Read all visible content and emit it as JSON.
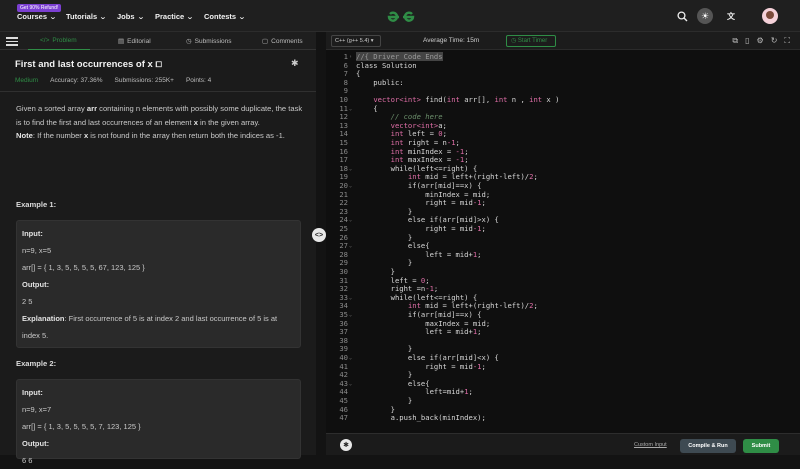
{
  "topnav": {
    "badge": "Get 90% Refund!",
    "items": [
      "Courses",
      "Tutorials",
      "Jobs",
      "Practice",
      "Contests"
    ],
    "logo": "GfG",
    "icons": [
      "search-icon",
      "sun-icon",
      "translate-icon",
      "avatar"
    ]
  },
  "tabs": [
    "Problem",
    "Editorial",
    "Submissions",
    "Comments"
  ],
  "problem": {
    "title": "First and last occurrences of x",
    "difficulty": "Medium",
    "accuracy": "Accuracy: 37.36%",
    "submissions": "Submissions: 255K+",
    "points": "Points: 4",
    "desc_1": "Given a sorted array ",
    "desc_arr": "arr",
    "desc_2": " containing n elements with possibly some duplicate, the task is to find the first and last occurrences of an element ",
    "desc_x": "x",
    "desc_3": " in the given array.",
    "note_label": "Note",
    "note_1": ": If the number ",
    "note_x": "x",
    "note_2": " is not found in the array then return both the indices as -1."
  },
  "examples": [
    {
      "heading": "Example 1:",
      "input_label": "Input:",
      "input_1": "n=9, x=5",
      "input_2": "arr[] = { 1, 3, 5, 5, 5, 5, 67, 123, 125 }",
      "output_label": "Output:",
      "output": "2 5",
      "expl_label": "Explanation",
      "expl": ": First occurrence of 5 is at index 2 and last occurrence of 5 is at index 5."
    },
    {
      "heading": "Example 2:",
      "input_label": "Input:",
      "input_1": "n=9, x=7",
      "input_2": "arr[] = { 1, 3, 5, 5, 5, 5, 7, 123, 125 }",
      "output_label": "Output:",
      "output": "6 6"
    }
  ],
  "editor": {
    "language": "C++ (g++ 5.4)",
    "avg_time": "Average Time: 15m",
    "timer": "Start Timer",
    "lines": [
      {
        "n": "1",
        "t": "//{ Driver Code Ends"
      },
      {
        "n": "6",
        "t": "class Solution"
      },
      {
        "n": "7",
        "t": "{"
      },
      {
        "n": "8",
        "t": "    public:"
      },
      {
        "n": "9",
        "t": ""
      },
      {
        "n": "10",
        "t": "    vector<int> find(int arr[], int n , int x )"
      },
      {
        "n": "11",
        "t": "    {"
      },
      {
        "n": "12",
        "t": "        // code here"
      },
      {
        "n": "13",
        "t": "        vector<int>a;"
      },
      {
        "n": "14",
        "t": "        int left = 0;"
      },
      {
        "n": "15",
        "t": "        int right = n-1;"
      },
      {
        "n": "16",
        "t": "        int minIndex = -1;"
      },
      {
        "n": "17",
        "t": "        int maxIndex = -1;"
      },
      {
        "n": "18",
        "t": "        while(left<=right) {"
      },
      {
        "n": "19",
        "t": "            int mid = left+(right-left)/2;"
      },
      {
        "n": "20",
        "t": "            if(arr[mid]==x) {"
      },
      {
        "n": "21",
        "t": "                minIndex = mid;"
      },
      {
        "n": "22",
        "t": "                right = mid-1;"
      },
      {
        "n": "23",
        "t": "            }"
      },
      {
        "n": "24",
        "t": "            else if(arr[mid]>x) {"
      },
      {
        "n": "25",
        "t": "                right = mid-1;"
      },
      {
        "n": "26",
        "t": "            }"
      },
      {
        "n": "27",
        "t": "            else{"
      },
      {
        "n": "28",
        "t": "                left = mid+1;"
      },
      {
        "n": "29",
        "t": "            }"
      },
      {
        "n": "30",
        "t": "        }"
      },
      {
        "n": "31",
        "t": "        left = 0;"
      },
      {
        "n": "32",
        "t": "        right =n-1;"
      },
      {
        "n": "33",
        "t": "        while(left<=right) {"
      },
      {
        "n": "34",
        "t": "            int mid = left+(right-left)/2;"
      },
      {
        "n": "35",
        "t": "            if(arr[mid]==x) {"
      },
      {
        "n": "36",
        "t": "                maxIndex = mid;"
      },
      {
        "n": "37",
        "t": "                left = mid+1;"
      },
      {
        "n": "38",
        "t": ""
      },
      {
        "n": "39",
        "t": "            }"
      },
      {
        "n": "40",
        "t": "            else if(arr[mid]<x) {"
      },
      {
        "n": "41",
        "t": "                right = mid-1;"
      },
      {
        "n": "42",
        "t": "            }"
      },
      {
        "n": "43",
        "t": "            else{"
      },
      {
        "n": "44",
        "t": "                left=mid+1;"
      },
      {
        "n": "45",
        "t": "            }"
      },
      {
        "n": "46",
        "t": "        }"
      },
      {
        "n": "47",
        "t": "        a.push_back(minIndex);"
      }
    ]
  },
  "bottom": {
    "custom_input": "Custom Input",
    "compile": "Compile & Run",
    "submit": "Submit"
  }
}
